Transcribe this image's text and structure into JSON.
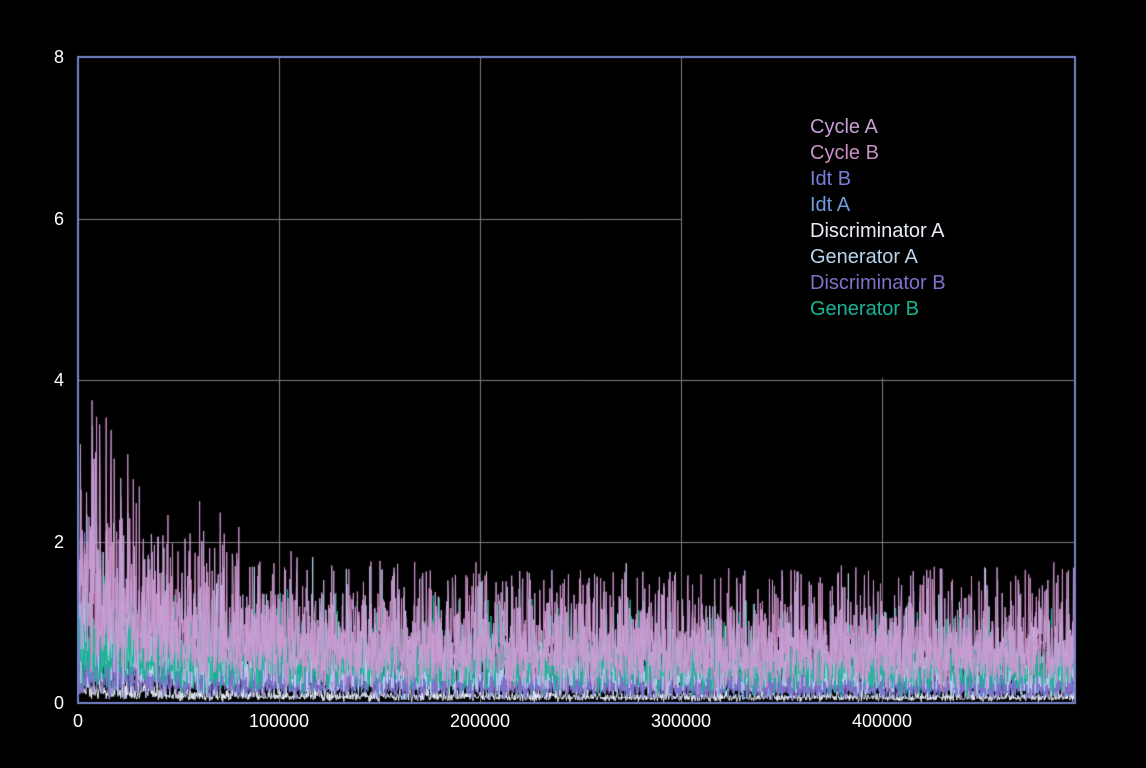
{
  "chart_data": {
    "type": "line",
    "title": "",
    "xlabel": "",
    "ylabel": "",
    "xlim": [
      0,
      496000
    ],
    "ylim": [
      0,
      8
    ],
    "x_ticks": [
      "0",
      "100000",
      "200000",
      "300000",
      "400000"
    ],
    "x_tick_values": [
      0,
      100000,
      200000,
      300000,
      400000
    ],
    "y_ticks": [
      "0",
      "2",
      "4",
      "6",
      "8"
    ],
    "y_tick_values": [
      0,
      2,
      4,
      6,
      8
    ],
    "grid": true,
    "legend_position": "upper-right",
    "colors": {
      "background": "#000000",
      "frame": "#7784ce",
      "grid": "#7d7d7d",
      "tick_label": "#ffffff"
    },
    "envelope_x": [
      0,
      50000,
      100000,
      150000,
      200000,
      250000,
      300000,
      350000,
      400000,
      450000
    ],
    "series": [
      {
        "name": "Cycle A",
        "color": "#c79fd6",
        "mean": [
          1.35,
          0.85,
          0.75,
          0.72,
          0.7,
          0.68,
          0.66,
          0.65,
          0.64,
          0.64
        ],
        "peak": [
          3.7,
          2.2,
          1.8,
          1.7,
          1.6,
          1.6,
          1.6,
          1.6,
          1.6,
          1.65
        ]
      },
      {
        "name": "Cycle B",
        "color": "#cb8fc6",
        "mean": [
          1.45,
          0.9,
          0.78,
          0.74,
          0.72,
          0.7,
          0.68,
          0.67,
          0.66,
          0.66
        ],
        "peak": [
          4.1,
          2.6,
          1.9,
          1.8,
          1.7,
          1.6,
          1.7,
          1.6,
          1.7,
          1.7
        ]
      },
      {
        "name": "Idt B",
        "color": "#7380d6",
        "mean": [
          0.62,
          0.38,
          0.32,
          0.3,
          0.28,
          0.27,
          0.26,
          0.25,
          0.25,
          0.24
        ],
        "peak": [
          2.4,
          1.0,
          0.8,
          0.75,
          0.7,
          0.65,
          0.65,
          0.6,
          0.6,
          0.6
        ]
      },
      {
        "name": "Idt A",
        "color": "#6f9ce0",
        "mean": [
          0.55,
          0.34,
          0.3,
          0.27,
          0.26,
          0.25,
          0.24,
          0.23,
          0.22,
          0.22
        ],
        "peak": [
          2.8,
          0.95,
          0.75,
          0.7,
          0.65,
          0.6,
          0.6,
          0.58,
          0.55,
          0.55
        ]
      },
      {
        "name": "Discriminator A",
        "color": "#e8edf8",
        "mean": [
          0.16,
          0.1,
          0.09,
          0.08,
          0.08,
          0.07,
          0.07,
          0.07,
          0.07,
          0.07
        ],
        "peak": [
          0.9,
          0.5,
          0.45,
          0.4,
          0.4,
          0.38,
          0.35,
          0.33,
          0.32,
          0.3
        ]
      },
      {
        "name": "Generator A",
        "color": "#b7d3ec",
        "mean": [
          0.7,
          0.52,
          0.48,
          0.46,
          0.44,
          0.43,
          0.42,
          0.41,
          0.4,
          0.4
        ],
        "peak": [
          2.6,
          2.1,
          1.9,
          1.8,
          1.7,
          1.9,
          2.1,
          1.7,
          1.9,
          1.7
        ]
      },
      {
        "name": "Discriminator B",
        "color": "#8370ca",
        "mean": [
          0.34,
          0.27,
          0.25,
          0.24,
          0.23,
          0.22,
          0.22,
          0.21,
          0.21,
          0.21
        ],
        "peak": [
          1.1,
          0.7,
          0.6,
          0.58,
          0.55,
          0.52,
          0.5,
          0.5,
          0.48,
          0.48
        ]
      },
      {
        "name": "Generator B",
        "color": "#17b493",
        "mean": [
          0.62,
          0.56,
          0.53,
          0.51,
          0.5,
          0.49,
          0.48,
          0.47,
          0.46,
          0.46
        ],
        "peak": [
          1.8,
          1.5,
          1.4,
          1.35,
          1.3,
          1.25,
          1.25,
          1.2,
          1.15,
          1.15
        ]
      }
    ],
    "draw_order": [
      4,
      3,
      2,
      6,
      5,
      7,
      1,
      0
    ],
    "legend_box_covers_grid": true
  }
}
